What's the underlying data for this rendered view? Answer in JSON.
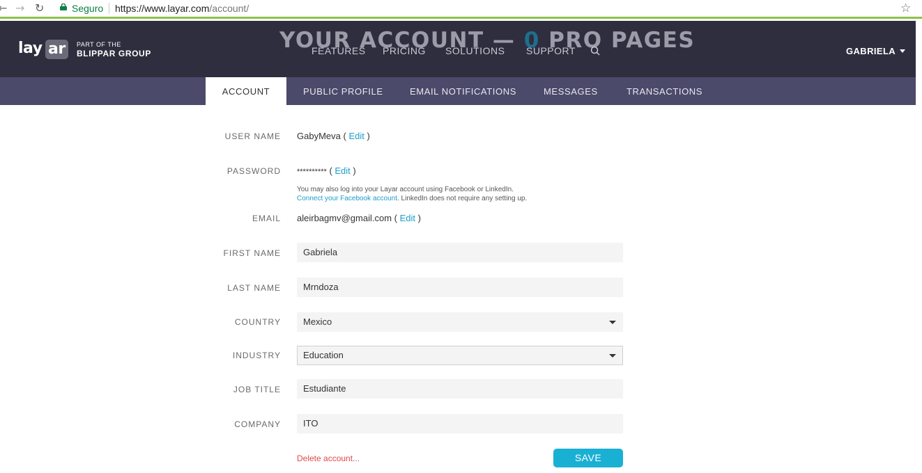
{
  "browser": {
    "secure_label": "Seguro",
    "url_host": "https://www.layar.com",
    "url_path": "/account/"
  },
  "header": {
    "logo_lay": "lay",
    "logo_ar": "ar",
    "group_line1": "PART OF THE",
    "group_line2": "BLIPPAR GROUP",
    "overlay_title_pre": "YOUR ACCOUNT — ",
    "overlay_title_num": "0",
    "overlay_title_post": " PRO PAGES",
    "nav": [
      "FEATURES",
      "PRICING",
      "SOLUTIONS",
      "SUPPORT"
    ],
    "user": "GABRIELA"
  },
  "tabs": [
    "ACCOUNT",
    "PUBLIC PROFILE",
    "EMAIL NOTIFICATIONS",
    "MESSAGES",
    "TRANSACTIONS"
  ],
  "form": {
    "username": {
      "label": "USER NAME",
      "value": "GabyMeva",
      "edit": "Edit"
    },
    "password": {
      "label": "PASSWORD",
      "value": "**********",
      "edit": "Edit"
    },
    "hint_line1": "You may also log into your Layar account using Facebook or LinkedIn.",
    "hint_link": "Connect your Facebook account",
    "hint_rest": ". LinkedIn does not require any setting up.",
    "email": {
      "label": "EMAIL",
      "value": "aleirbagmv@gmail.com",
      "edit": "Edit"
    },
    "first_name": {
      "label": "FIRST NAME",
      "value": "Gabriela"
    },
    "last_name": {
      "label": "LAST NAME",
      "value": "Mrndoza"
    },
    "country": {
      "label": "COUNTRY",
      "value": "Mexico"
    },
    "industry": {
      "label": "INDUSTRY",
      "value": "Education"
    },
    "job_title": {
      "label": "JOB TITLE",
      "value": "Estudiante"
    },
    "company": {
      "label": "COMPANY",
      "value": "ITO"
    },
    "delete_label": "Delete account...",
    "save_label": "SAVE"
  },
  "colors": {
    "header_bg": "#2e2e3f",
    "tabbar_bg": "#4b4a6a",
    "link": "#1a9fc9",
    "save_button": "#1ab0d4",
    "delete": "#e04a4a"
  }
}
